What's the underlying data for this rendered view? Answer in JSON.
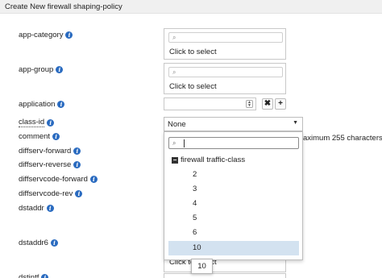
{
  "header": {
    "title": "Create New firewall shaping-policy"
  },
  "fields": {
    "app_category": "app-category",
    "app_group": "app-group",
    "application": "application",
    "class_id": "class-id",
    "comment": "comment",
    "diffserv_forward": "diffserv-forward",
    "diffserv_reverse": "diffserv-reverse",
    "diffservcode_forward": "diffservcode-forward",
    "diffservcode_rev": "diffservcode-rev",
    "dstaddr": "dstaddr",
    "dstaddr6": "dstaddr6",
    "dstintf": "dstintf"
  },
  "multiselect": {
    "hint": "Click to select"
  },
  "buttons": {
    "clear": "✖",
    "add": "+"
  },
  "class_select": {
    "value": "None"
  },
  "comment_counter": "aximum 255 characters)",
  "dropdown": {
    "group_label": "firewall traffic-class",
    "options": [
      "2",
      "3",
      "4",
      "5",
      "6",
      "10"
    ],
    "selected": "10"
  },
  "tooltip": "10",
  "icons": {
    "info": "info-icon",
    "search": "search-icon",
    "caret": "caret-down-icon",
    "collapse": "minus-square-icon"
  },
  "colors": {
    "info_blue": "#2a6bc0",
    "selected_row": "#d3e2f0"
  }
}
